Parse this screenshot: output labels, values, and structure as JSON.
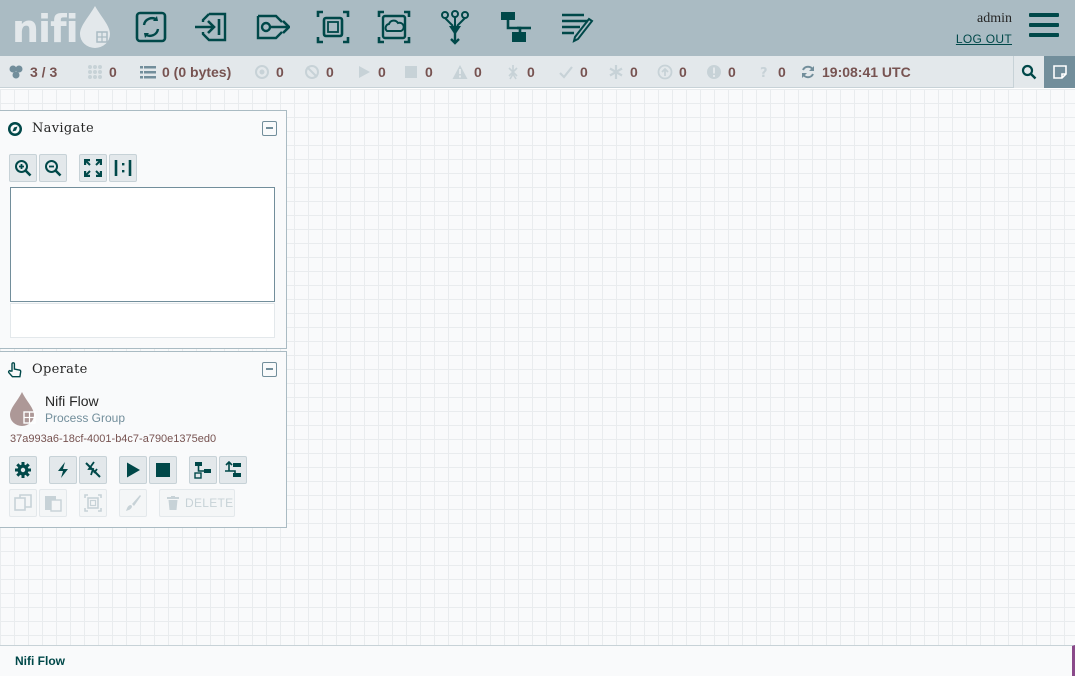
{
  "header": {
    "logo_text": "nifi",
    "toolbar": [
      {
        "name": "processor",
        "icon": "processor-icon"
      },
      {
        "name": "input-port",
        "icon": "input-port-icon"
      },
      {
        "name": "output-port",
        "icon": "output-port-icon"
      },
      {
        "name": "process-group",
        "icon": "process-group-icon"
      },
      {
        "name": "remote-process-group",
        "icon": "remote-process-group-icon"
      },
      {
        "name": "funnel",
        "icon": "funnel-icon"
      },
      {
        "name": "template",
        "icon": "template-icon"
      },
      {
        "name": "label",
        "icon": "label-icon"
      }
    ],
    "user": "admin",
    "logout_label": "LOG OUT"
  },
  "status_bar": {
    "cluster": "3 / 3",
    "transmitting": "0",
    "queued": "0 (0 bytes)",
    "remote_transmitting": "0",
    "remote_not_transmitting": "0",
    "running": "0",
    "stopped": "0",
    "invalid": "0",
    "disabled": "0",
    "up_to_date": "0",
    "locally_modified": "0",
    "stale": "0",
    "locally_modified_stale": "0",
    "sync_failure": "0",
    "last_refreshed": "19:08:41 UTC"
  },
  "navigate": {
    "title": "Navigate"
  },
  "operate": {
    "title": "Operate",
    "component_name": "Nifi Flow",
    "component_type": "Process Group",
    "component_id": "37a993a6-18cf-4001-b4c7-a790e1375ed0",
    "delete_label": "DELETE"
  },
  "footer": {
    "breadcrumb": "Nifi Flow"
  },
  "colors": {
    "header_bg": "#aabbc3",
    "status_bg": "#e3e8eb",
    "accent": "#004849",
    "value": "#775351",
    "muted": "#728e9b"
  }
}
